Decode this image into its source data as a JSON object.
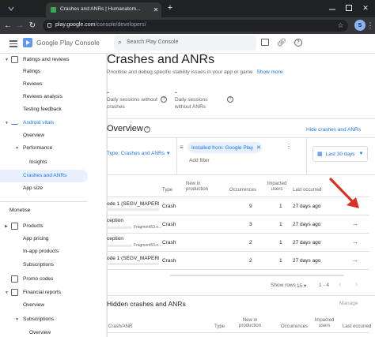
{
  "browser": {
    "tab_title": "Crashes and ANRs | Humanatom...",
    "url_host": "play.google.com",
    "url_path": "/console/developers/",
    "avatar_letter": "S"
  },
  "header": {
    "app_name": "Google Play Console",
    "search_placeholder": "Search Play Console"
  },
  "sidebar": {
    "items": [
      {
        "label": "Ratings and reviews"
      },
      {
        "label": "Ratings"
      },
      {
        "label": "Reviews"
      },
      {
        "label": "Reviews analysis"
      },
      {
        "label": "Testing feedback"
      },
      {
        "label": "Android vitals"
      },
      {
        "label": "Overview"
      },
      {
        "label": "Performance"
      },
      {
        "label": "Insights"
      },
      {
        "label": "Crashes and ANRs"
      },
      {
        "label": "App size"
      },
      {
        "label": "Monetise"
      },
      {
        "label": "Products"
      },
      {
        "label": "App pricing"
      },
      {
        "label": "In-app products"
      },
      {
        "label": "Subscriptions"
      },
      {
        "label": "Promo codes"
      },
      {
        "label": "Financial reports"
      },
      {
        "label": "Overview"
      },
      {
        "label": "Subscriptions"
      },
      {
        "label": "Overview"
      }
    ]
  },
  "main": {
    "title": "Crashes and ANRs",
    "subtitle": "Prioritise and debug specific stability issues in your app or game",
    "show_more": "Show more",
    "metrics": [
      {
        "value": "-",
        "label": "Daily sessions without crashes"
      },
      {
        "value": "-",
        "label": "Daily sessions without ANRs"
      }
    ],
    "overview_title": "Overview",
    "hide_link": "Hide crashes and ANRs",
    "type_filter": "Type: Crashes and ANRs",
    "installed_chip": "Installed from: Google Play",
    "add_filter": "Add filter",
    "date_range": "Last 30 days",
    "table": {
      "headers": [
        "Type",
        "New in production",
        "Occurrences",
        "Impacted users",
        "Last occurred"
      ],
      "rows": [
        {
          "name": "ode 1 (SEGV_MAPERR)",
          "detail": "",
          "type": "Crash",
          "new": "",
          "occ": "9",
          "users": "1",
          "last": "27 days ago"
        },
        {
          "name": "ception",
          "detail": "Fragment53.o...",
          "type": "Crash",
          "new": "",
          "occ": "3",
          "users": "1",
          "last": "27 days ago"
        },
        {
          "name": "ception",
          "detail": "Fragment53.o...",
          "type": "Crash",
          "new": "",
          "occ": "2",
          "users": "1",
          "last": "27 days ago"
        },
        {
          "name": "ode 1 (SEGV_MAPERR)",
          "detail": "",
          "type": "Crash",
          "new": "",
          "occ": "2",
          "users": "1",
          "last": "27 days ago"
        }
      ]
    },
    "pagination": {
      "show_rows_label": "Show rows",
      "rows_value": "15",
      "range": "1 - 4"
    },
    "hidden_title": "Hidden crashes and ANRs",
    "manage": "Manage",
    "hidden_headers": [
      "Crash/ANR",
      "Type",
      "New in production",
      "Occurrences",
      "Impacted users",
      "Last occurred"
    ]
  },
  "colors": {
    "accent": "#1a73e8",
    "annotation": "#d93025"
  }
}
